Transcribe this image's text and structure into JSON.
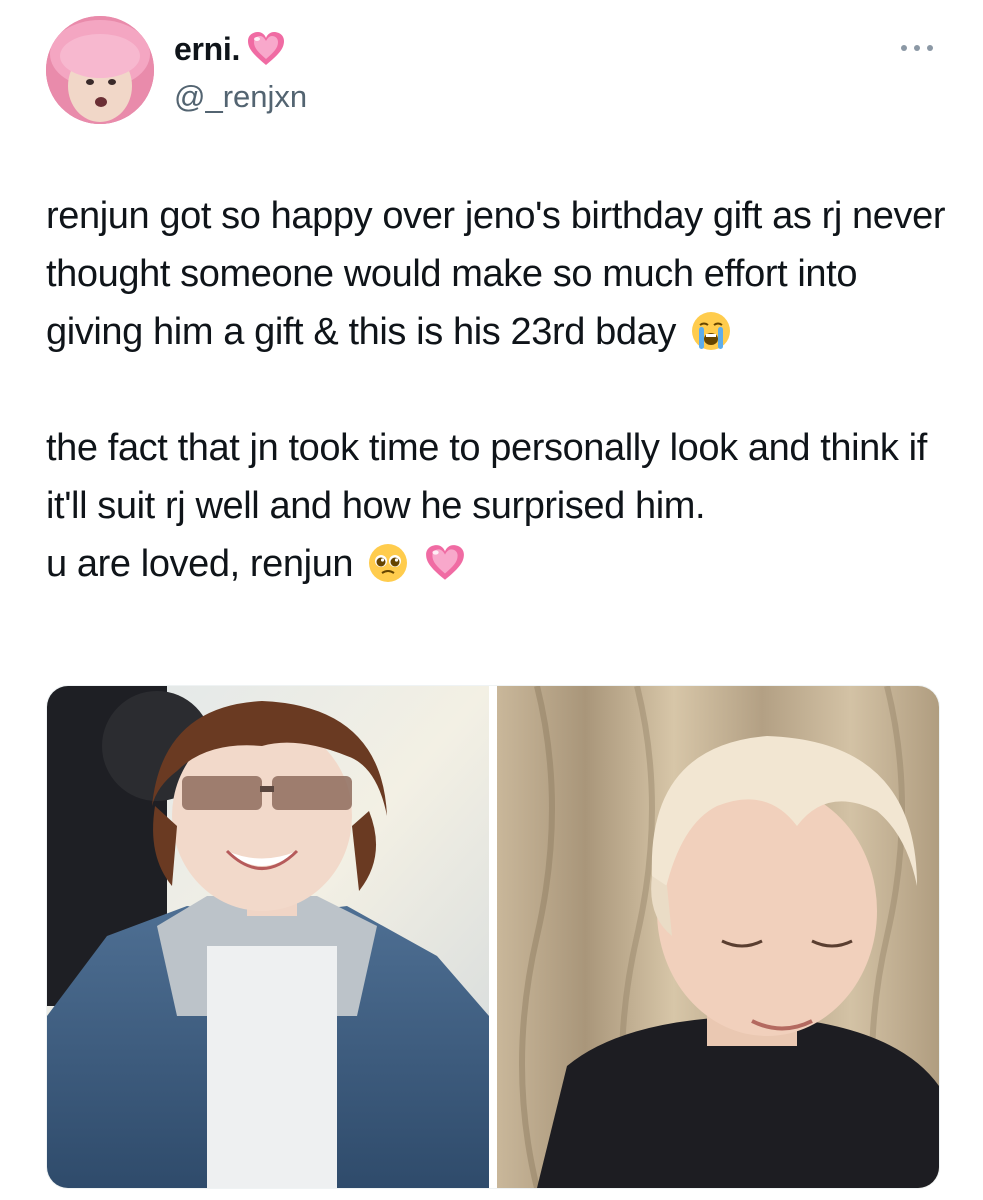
{
  "author": {
    "display_name": "erni.",
    "handle": "@_renjxn",
    "avatar_icon": "avatar-photo",
    "name_emoji": "sparkling-heart-icon"
  },
  "tweet": {
    "paragraph_1": "renjun got so happy over jeno's birthday gift as rj never thought someone would make so much effort into giving him a gift & this is his 23rd bday",
    "paragraph_1_emoji": "loudly-crying-face-icon",
    "paragraph_2": "the fact that jn took time to personally look and think if it'll suit rj well and how he surprised him.",
    "paragraph_3": "u are loved, renjun",
    "paragraph_3_emojis": [
      "pleading-face-icon",
      "sparkling-heart-icon"
    ]
  },
  "media": {
    "count": 2,
    "photos": [
      "photo-1",
      "photo-2"
    ]
  },
  "colors": {
    "text": "#0f1419",
    "secondary": "#536471",
    "heart": "#f06ba3"
  }
}
